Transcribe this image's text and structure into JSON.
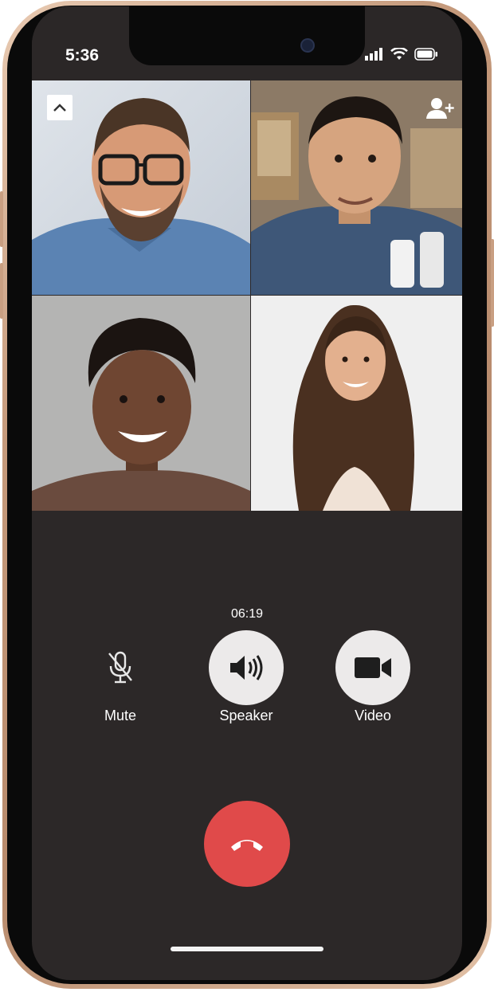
{
  "status_bar": {
    "time": "5:36",
    "icons": [
      "signal-icon",
      "wifi-icon",
      "battery-icon"
    ]
  },
  "video_grid": {
    "participants": [
      {
        "position": "top-left"
      },
      {
        "position": "top-right"
      },
      {
        "position": "bottom-left"
      },
      {
        "position": "bottom-right"
      }
    ],
    "collapse_icon": "chevron-up-icon",
    "add_participant_icon": "add-person-icon"
  },
  "call": {
    "duration": "06:19",
    "controls": {
      "mute_label": "Mute",
      "speaker_label": "Speaker",
      "video_label": "Video"
    },
    "end_call_icon": "phone-hangup-icon"
  },
  "colors": {
    "background": "#2c2828",
    "control_fill": "#eceaea",
    "end_call": "#e04a4a",
    "frame_gold": "#c59a7c"
  }
}
